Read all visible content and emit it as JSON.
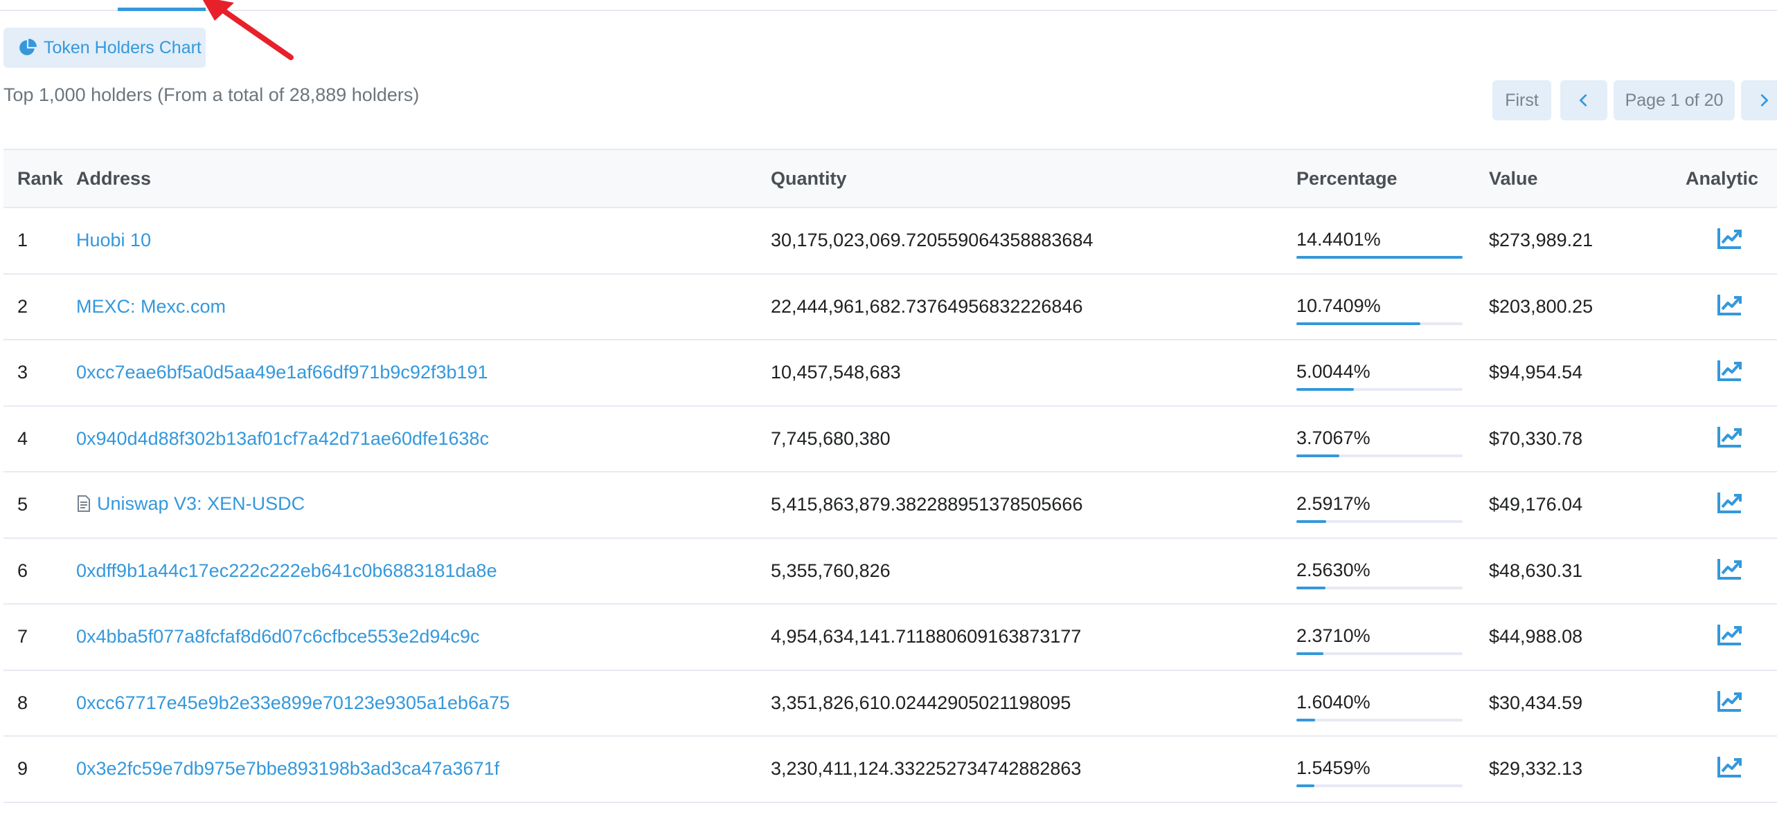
{
  "chart_button": {
    "label": "Token Holders Chart",
    "icon": "pie-chart-icon"
  },
  "summary": "Top 1,000 holders (From a total of 28,889 holders)",
  "pagination": {
    "first": "First",
    "prev_icon": "chevron-left-icon",
    "page": "Page 1 of 20",
    "next_icon": "chevron-right-icon"
  },
  "table": {
    "headers": {
      "rank": "Rank",
      "address": "Address",
      "quantity": "Quantity",
      "percentage": "Percentage",
      "value": "Value",
      "analytics": "Analytic"
    },
    "rows": [
      {
        "rank": "1",
        "address": "Huobi 10",
        "quantity": "30,175,023,069.720559064358883684",
        "percentage": "14.4401%",
        "pct_fill": 1.0,
        "value": "$273,989.21",
        "contract": false
      },
      {
        "rank": "2",
        "address": "MEXC: Mexc.com",
        "quantity": "22,444,961,682.73764956832226846",
        "percentage": "10.7409%",
        "pct_fill": 0.744,
        "value": "$203,800.25",
        "contract": false
      },
      {
        "rank": "3",
        "address": "0xcc7eae6bf5a0d5aa49e1af66df971b9c92f3b191",
        "quantity": "10,457,548,683",
        "percentage": "5.0044%",
        "pct_fill": 0.347,
        "value": "$94,954.54",
        "contract": false
      },
      {
        "rank": "4",
        "address": "0x940d4d88f302b13af01cf7a42d71ae60dfe1638c",
        "quantity": "7,745,680,380",
        "percentage": "3.7067%",
        "pct_fill": 0.257,
        "value": "$70,330.78",
        "contract": false
      },
      {
        "rank": "5",
        "address": "Uniswap V3: XEN-USDC",
        "quantity": "5,415,863,879.382288951378505666",
        "percentage": "2.5917%",
        "pct_fill": 0.179,
        "value": "$49,176.04",
        "contract": true
      },
      {
        "rank": "6",
        "address": "0xdff9b1a44c17ec222c222eb641c0b6883181da8e",
        "quantity": "5,355,760,826",
        "percentage": "2.5630%",
        "pct_fill": 0.177,
        "value": "$48,630.31",
        "contract": false
      },
      {
        "rank": "7",
        "address": "0x4bba5f077a8fcfaf8d6d07c6cfbce553e2d94c9c",
        "quantity": "4,954,634,141.711880609163873177",
        "percentage": "2.3710%",
        "pct_fill": 0.164,
        "value": "$44,988.08",
        "contract": false
      },
      {
        "rank": "8",
        "address": "0xcc67717e45e9b2e33e899e70123e9305a1eb6a75",
        "quantity": "3,351,826,610.02442905021198095",
        "percentage": "1.6040%",
        "pct_fill": 0.111,
        "value": "$30,434.59",
        "contract": false
      },
      {
        "rank": "9",
        "address": "0x3e2fc59e7db975e7bbe893198b3ad3ca47a3671f",
        "quantity": "3,230,411,124.332252734742882863",
        "percentage": "1.5459%",
        "pct_fill": 0.107,
        "value": "$29,332.13",
        "contract": false
      }
    ]
  },
  "colors": {
    "accent": "#3498db",
    "button_bg": "#e3eef9",
    "arrow": "#e8202a"
  }
}
